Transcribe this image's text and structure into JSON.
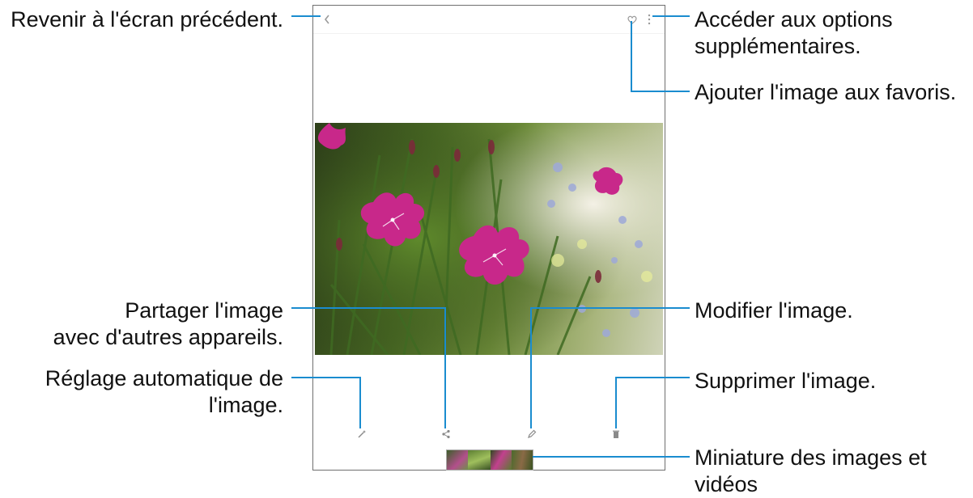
{
  "callouts": {
    "back": "Revenir à l'écran précédent.",
    "more_options": [
      "Accéder aux options",
      "supplémentaires."
    ],
    "favorite": "Ajouter l'image aux favoris.",
    "share": [
      "Partager l'image",
      "avec d'autres appareils."
    ],
    "edit": "Modifier l'image.",
    "auto_adjust": [
      "Réglage automatique de",
      "l'image."
    ],
    "delete": "Supprimer l'image.",
    "thumbnails": [
      "Miniature des images et",
      "vidéos"
    ]
  },
  "icons": {
    "back": "chevron-left-icon",
    "favorite": "heart-icon",
    "more": "vertical-dots-icon",
    "auto_adjust": "magic-wand-icon",
    "share": "share-icon",
    "edit": "pencil-icon",
    "delete": "trash-icon"
  },
  "colors": {
    "leader_line": "#1a8ccf",
    "flower": "#c8288a"
  }
}
